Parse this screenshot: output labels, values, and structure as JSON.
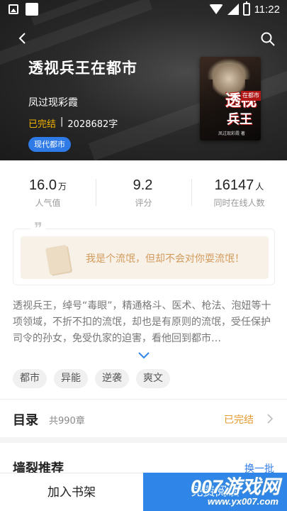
{
  "status_bar": {
    "time": "11:22"
  },
  "book": {
    "title": "透视兵王在都市",
    "author": "凤过现彩霞",
    "status": "已完结",
    "separator": "|",
    "word_count": "2028682字",
    "genre": "现代都市",
    "cover_title_line1": "透视",
    "cover_title_line2": "兵王",
    "cover_badge": "在都市",
    "cover_author": "凤过现彩霞 著"
  },
  "stats": [
    {
      "value": "16.0",
      "unit": "万",
      "label": "人气值"
    },
    {
      "value": "9.2",
      "unit": "",
      "label": "评分"
    },
    {
      "value": "16147",
      "unit": "人",
      "label": "同时在线人数"
    }
  ],
  "quote": {
    "mark": "❞",
    "text": "我是个流氓，但却不会对你耍流氓！"
  },
  "synopsis": "透视兵王，绰号“毒眼”，精通格斗、医术、枪法、泡妞等十项领域，不折不扣的流氓，却也是有原则的流氓，受任保护司令的孙女，免受仇家的迫害，看他回到都市…",
  "tags": [
    "都市",
    "异能",
    "逆袭",
    "爽文"
  ],
  "catalog": {
    "title": "目录",
    "count": "共990章",
    "status": "已完结"
  },
  "recommend": {
    "title": "墙裂推荐",
    "more": "换一批"
  },
  "bottom": {
    "shelf_label": "加入书架",
    "read_label": "免费阅读"
  },
  "watermark": {
    "main": "007游戏网",
    "sub": "www.yx007.com"
  },
  "colors": {
    "accent_blue": "#2f86e8",
    "status_orange": "#e39a2e",
    "quote_text": "#d39b5c"
  }
}
